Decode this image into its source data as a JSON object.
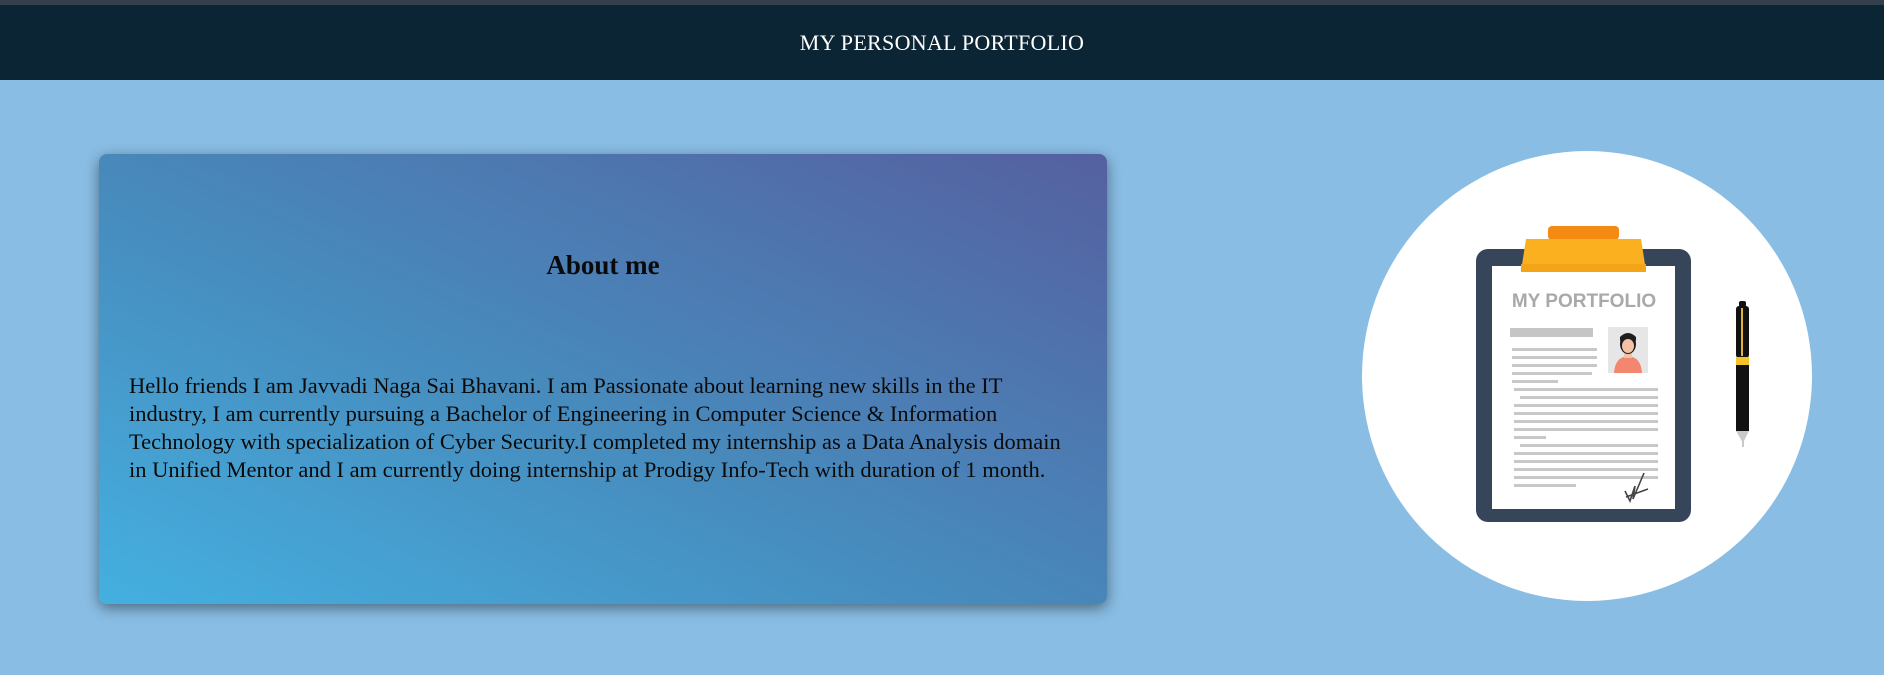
{
  "header": {
    "title": "MY PERSONAL PORTFOLIO"
  },
  "about": {
    "heading": "About me",
    "body": "Hello friends I am Javvadi Naga Sai Bhavani. I am Passionate about learning new skills in the IT industry, I am currently pursuing a Bachelor of Engineering in Computer Science & Information Technology with specialization of Cyber Security.I completed my internship as a Data Analysis domain in Unified Mentor and I am currently doing internship at Prodigy Info-Tech with duration of 1 month."
  },
  "illustration": {
    "sheet_title": "MY PORTFOLIO"
  },
  "colors": {
    "page_background": "#89bde4",
    "header_background": "#0b2535",
    "card_gradient_start": "#44b0e0",
    "card_gradient_end": "#5560a0",
    "clip_accent": "#fbb020"
  }
}
